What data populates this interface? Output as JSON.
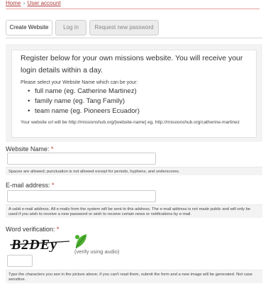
{
  "breadcrumb": {
    "home": "Home",
    "separator": "›",
    "current": "User account"
  },
  "tabs": [
    {
      "label": "Create Website"
    },
    {
      "label": "Log in"
    },
    {
      "label": "Request new password"
    }
  ],
  "intro": {
    "heading": "Register below for your own missions website. You will receive your login details within a day.",
    "please": "Please select your Website Name which can be your:",
    "options": [
      "full name (eg. Catherine Martinez)",
      "family name (eg. Tang Family)",
      "team name (eg. Pioneers Ecuador)"
    ],
    "url_note": "Your website url will be http://missionshub.org/[website-name] eg. http://missionshub.org/catherine-martinez"
  },
  "website_name": {
    "label": "Website Name:",
    "required": "*",
    "value": "",
    "help": "Spaces are allowed; punctuation is not allowed except for periods, hyphens, and underscores."
  },
  "email": {
    "label": "E-mail address:",
    "required": "*",
    "value": "",
    "help": "A valid e-mail address. All e-mails from the system will be sent to this address. The e-mail address is not made public and will only be used if you wish to receive a new password or wish to receive certain news or notifications by e-mail."
  },
  "captcha": {
    "label": "Word verification:",
    "required": "*",
    "image_text": "B2DEy",
    "audio_prefix": "(verify using ",
    "audio_link": "audio",
    "audio_suffix": ")",
    "value": "",
    "help": "Type the characters you see in the picture above; if you can't read them, submit the form and a new image will be generated. Not case sensitive."
  },
  "colors": {
    "accent": "#b03a3a",
    "required": "#c0392b",
    "panel": "#f3f3f3",
    "leaf": "#4caf2f"
  }
}
